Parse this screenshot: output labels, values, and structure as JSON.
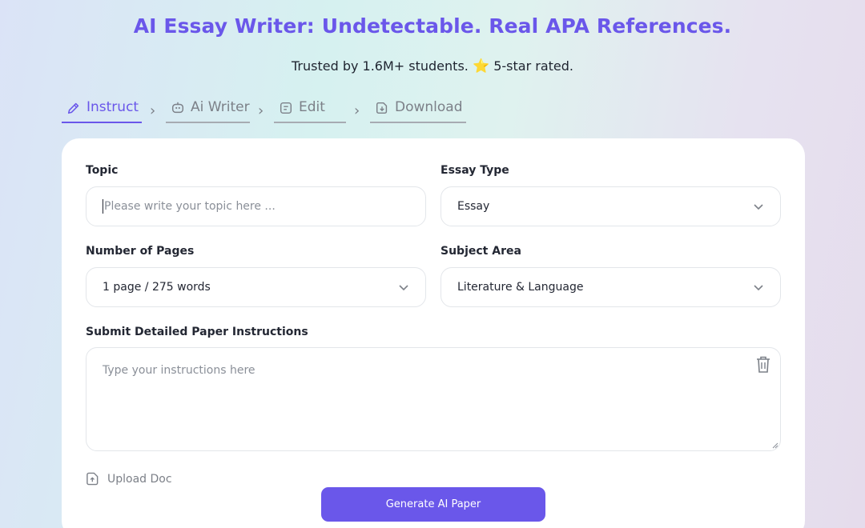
{
  "header": {
    "title": "AI Essay Writer: Undetectable. Real APA References.",
    "subtitle_text": "Trusted by 1.6M+ students.",
    "star_icon": "⭐",
    "rating_text": "5-star rated."
  },
  "steps": [
    {
      "label": "Instruct",
      "icon": "pencil-icon",
      "active": true
    },
    {
      "label": "Ai Writer",
      "icon": "robot-icon",
      "active": false
    },
    {
      "label": "Edit",
      "icon": "document-edit-icon",
      "active": false
    },
    {
      "label": "Download",
      "icon": "download-icon",
      "active": false
    }
  ],
  "form": {
    "topic": {
      "label": "Topic",
      "placeholder": "Please write your topic here ...",
      "value": ""
    },
    "essay_type": {
      "label": "Essay Type",
      "value": "Essay"
    },
    "pages": {
      "label": "Number of Pages",
      "value": "1 page / 275 words"
    },
    "subject": {
      "label": "Subject Area",
      "value": "Literature & Language"
    },
    "instructions": {
      "label": "Submit Detailed Paper Instructions",
      "placeholder": "Type your instructions here",
      "value": ""
    },
    "upload_label": "Upload Doc",
    "generate_label": "Generate AI Paper"
  },
  "colors": {
    "accent": "#6a57ea",
    "muted": "#7c8088",
    "card": "#ffffff"
  }
}
